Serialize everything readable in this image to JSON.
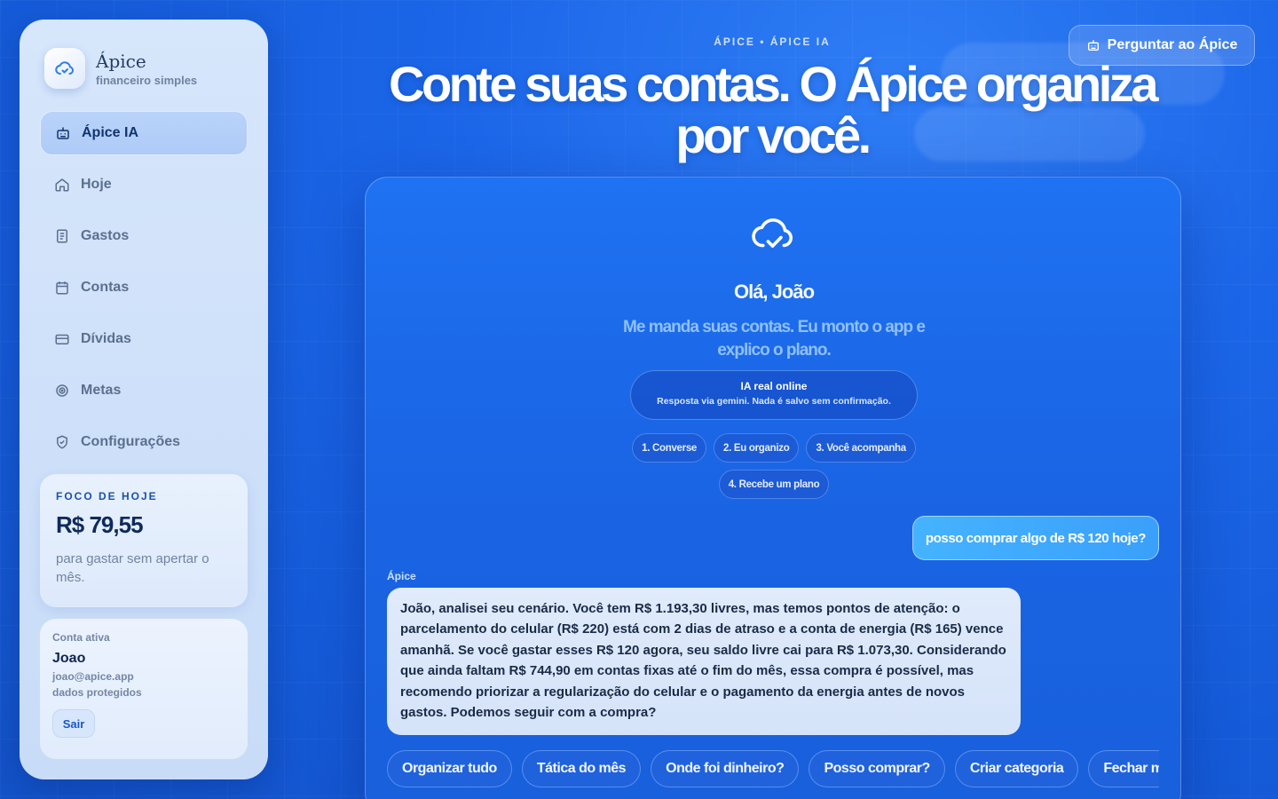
{
  "sidebar": {
    "brand": {
      "name": "Ápice",
      "tagline": "financeiro simples"
    },
    "nav": [
      {
        "label": "Ápice IA",
        "icon": "bot-icon",
        "active": true
      },
      {
        "label": "Hoje",
        "icon": "home-icon"
      },
      {
        "label": "Gastos",
        "icon": "receipt-icon"
      },
      {
        "label": "Contas",
        "icon": "calendar-icon"
      },
      {
        "label": "Dívidas",
        "icon": "card-icon"
      },
      {
        "label": "Metas",
        "icon": "target-icon"
      },
      {
        "label": "Configurações",
        "icon": "shield-icon"
      }
    ],
    "focus": {
      "label": "FOCO DE HOJE",
      "value": "R$ 79,55",
      "description": "para gastar sem apertar o mês."
    },
    "account": {
      "label": "Conta ativa",
      "name": "Joao",
      "email": "joao@apice.app",
      "status": "dados protegidos",
      "logout": "Sair"
    }
  },
  "header": {
    "eyebrow": "ÁPICE • ÁPICE IA",
    "headline": "Conte suas contas. O Ápice organiza por você.",
    "ask_button": "Perguntar ao Ápice"
  },
  "chat": {
    "greeting": "Olá, João",
    "intro": "Me manda suas contas. Eu monto o app e explico o plano.",
    "ai_badge": {
      "title": "IA real online",
      "subtitle": "Resposta via gemini. Nada é salvo sem confirmação."
    },
    "steps": [
      "1. Converse",
      "2. Eu organizo",
      "3. Você acompanha",
      "4. Recebe um plano"
    ],
    "user_message": "posso comprar algo de R$ 120 hoje?",
    "bot_label": "Ápice",
    "bot_message": "João, analisei seu cenário. Você tem R$ 1.193,30 livres, mas temos pontos de atenção: o parcelamento do celular (R$ 220) está com 2 dias de atraso e a conta de energia (R$ 165) vence amanhã. Se você gastar esses R$ 120 agora, seu saldo livre cai para R$ 1.073,30. Considerando que ainda faltam R$ 744,90 em contas fixas até o fim do mês, essa compra é possível, mas recomendo priorizar a regularização do celular e o pagamento da energia antes de novos gastos. Podemos seguir com a compra?",
    "quick_actions": [
      "Organizar tudo",
      "Tática do mês",
      "Onde foi dinheiro?",
      "Posso comprar?",
      "Criar categoria",
      "Fechar mês"
    ]
  },
  "colors": {
    "accent": "#1b66e8",
    "panel": "#1a66e6",
    "sidebar": "#d6e6fb"
  }
}
